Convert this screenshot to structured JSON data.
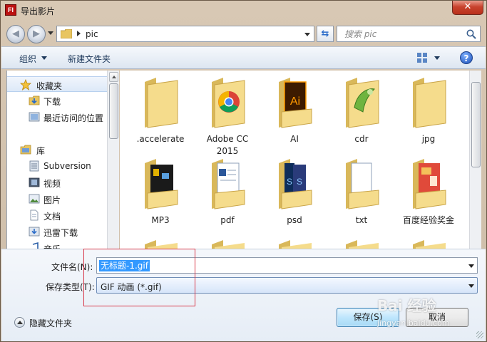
{
  "window": {
    "title": "导出影片",
    "app_icon_text": "Fl",
    "close_symbol": "✕"
  },
  "address": {
    "path_segment": "pic"
  },
  "search": {
    "placeholder": "搜索 pic"
  },
  "toolbar": {
    "organize_label": "组织",
    "new_folder_label": "新建文件夹",
    "help_symbol": "?"
  },
  "sidebar": {
    "items": [
      {
        "label": "收藏夹",
        "icon": "star-icon"
      },
      {
        "label": "下载",
        "icon": "download-folder-icon"
      },
      {
        "label": "最近访问的位置",
        "icon": "recent-places-icon"
      },
      {
        "label": "库",
        "icon": "library-icon"
      },
      {
        "label": "Subversion",
        "icon": "subversion-library-icon"
      },
      {
        "label": "视频",
        "icon": "video-library-icon"
      },
      {
        "label": "图片",
        "icon": "pictures-library-icon"
      },
      {
        "label": "文档",
        "icon": "documents-library-icon"
      },
      {
        "label": "迅雷下载",
        "icon": "xunlei-download-icon"
      },
      {
        "label": "音乐",
        "icon": "music-library-icon"
      }
    ]
  },
  "files": [
    {
      "label": ".accelerate",
      "icon": "plain-folder-icon"
    },
    {
      "label": "Adobe CC 2015",
      "icon": "chrome-folder-icon"
    },
    {
      "label": "AI",
      "icon": "illustrator-folder-icon"
    },
    {
      "label": "cdr",
      "icon": "coreldraw-folder-icon"
    },
    {
      "label": "jpg",
      "icon": "plain-folder-icon"
    },
    {
      "label": "MP3",
      "icon": "media-folder-icon"
    },
    {
      "label": "pdf",
      "icon": "document-folder-icon"
    },
    {
      "label": "psd",
      "icon": "photoshop-folder-icon"
    },
    {
      "label": "txt",
      "icon": "text-folder-icon"
    },
    {
      "label": "百度经验奖金",
      "icon": "image-folder-icon"
    }
  ],
  "form": {
    "filename_label": "文件名(N):",
    "filename_value": "无标题-1.gif",
    "filetype_label": "保存类型(T):",
    "filetype_value": "GIF 动画 (*.gif)"
  },
  "footer": {
    "hide_folders_label": "隐藏文件夹",
    "save_label": "保存(S)",
    "cancel_label": "取消"
  },
  "watermark": {
    "text": "Bai 经验",
    "sub": "jingyan.baidu.com"
  },
  "colors": {
    "selection": "#3399ff",
    "folder": "#f2d27a",
    "highlight_box": "#d8394a"
  }
}
